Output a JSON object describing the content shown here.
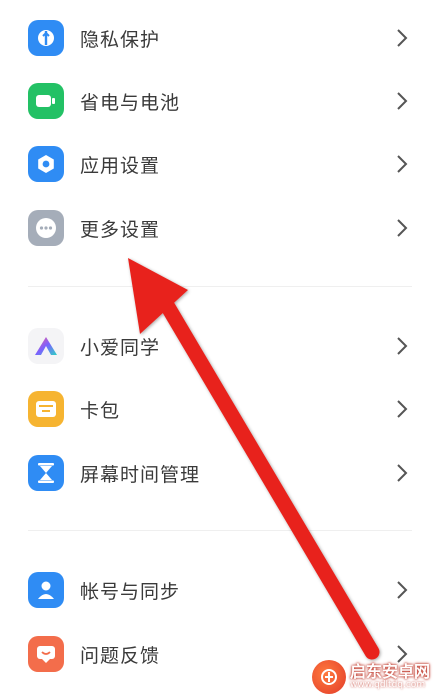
{
  "colors": {
    "privacy": "#2f8cf4",
    "battery": "#23c165",
    "app_settings": "#2f8cf4",
    "more_settings": "#a5adb9",
    "xiaoai": "#f4f4f6",
    "wallet": "#f6b431",
    "screen_time": "#2f8cf4",
    "account": "#2f8cf4",
    "feedback": "#f36d4b",
    "arrow": "#e8231e"
  },
  "section1": {
    "items": [
      {
        "label": "隐私保护",
        "icon": "shield-icon"
      },
      {
        "label": "省电与电池",
        "icon": "battery-icon"
      },
      {
        "label": "应用设置",
        "icon": "gear-icon"
      },
      {
        "label": "更多设置",
        "icon": "more-dots-icon"
      }
    ]
  },
  "section2": {
    "items": [
      {
        "label": "小爱同学",
        "icon": "xiaoai-icon"
      },
      {
        "label": "卡包",
        "icon": "wallet-icon"
      },
      {
        "label": "屏幕时间管理",
        "icon": "hourglass-icon"
      }
    ]
  },
  "section3": {
    "items": [
      {
        "label": "帐号与同步",
        "icon": "person-icon"
      },
      {
        "label": "问题反馈",
        "icon": "feedback-icon"
      }
    ]
  },
  "watermark": {
    "title": "启东安卓网",
    "url": "www.qdltdq.com"
  }
}
